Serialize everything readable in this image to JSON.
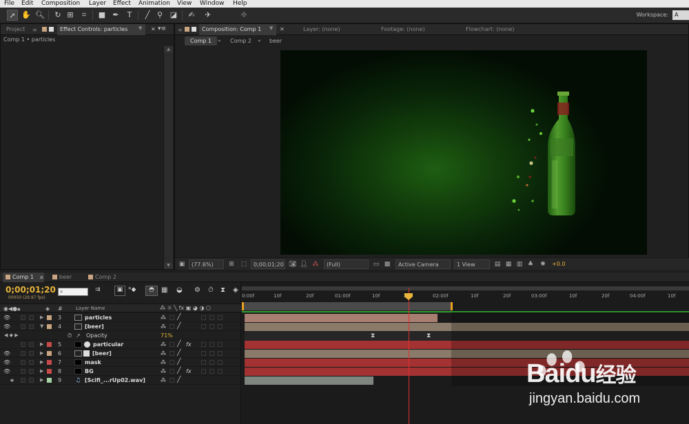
{
  "menu": [
    "File",
    "Edit",
    "Composition",
    "Layer",
    "Effect",
    "Animation",
    "View",
    "Window",
    "Help"
  ],
  "workspace": {
    "label": "Workspace:",
    "value": "A"
  },
  "left_panel": {
    "tab_project": "Project",
    "tab_effects": "Effect Controls: particles",
    "breadcrumb": "Comp 1 • particles"
  },
  "comp_panel": {
    "tab_composition": "Composition: Comp 1",
    "tab_layer": "Layer: (none)",
    "tab_footage": "Footage: (none)",
    "tab_flowchart": "Flowchart: (none)",
    "crumbs": [
      "Comp 1",
      "Comp 2",
      "beer"
    ],
    "zoom": "(77.6%)",
    "timecode": "0;00;01;20",
    "resolution": "(Full)",
    "camera": "Active Camera",
    "view": "1 View",
    "exposure": "+0.0",
    "bottle_label": "Heineken"
  },
  "timeline": {
    "tabs": [
      "Comp 1",
      "beer",
      "Comp 2"
    ],
    "timecode": "0;00;01;20",
    "frames": "00050 (29.97 fps)",
    "search_placeholder": "",
    "col_num": "#",
    "col_layer": "Layer Name",
    "ruler": [
      "0:00f",
      "10f",
      "20f",
      "01:00f",
      "10f",
      "20f",
      "02:00f",
      "10f",
      "20f",
      "03:00f",
      "10f",
      "20f",
      "04:00f",
      "10f"
    ],
    "layers": [
      {
        "num": "3",
        "name": "particles",
        "color": "#c9a581",
        "expanded": false,
        "fx": false
      },
      {
        "num": "4",
        "name": "[beer]",
        "color": "#c9a581",
        "expanded": true,
        "fx": false
      },
      {
        "num": "5",
        "name": "particular",
        "color": "#c84b4b",
        "expanded": false,
        "fx": true
      },
      {
        "num": "6",
        "name": "[beer]",
        "color": "#c9a581",
        "expanded": false,
        "fx": false
      },
      {
        "num": "7",
        "name": "mask",
        "color": "#c84b4b",
        "expanded": false,
        "fx": false
      },
      {
        "num": "8",
        "name": "BG",
        "color": "#c84b4b",
        "expanded": false,
        "fx": true
      },
      {
        "num": "9",
        "name": "[Scifi_...rUp02.wav]",
        "color": "#a5d3a5",
        "expanded": false,
        "fx": false
      }
    ],
    "property": {
      "name": "Opacity",
      "value": "71%"
    }
  },
  "watermark": {
    "brand_left": "Bai",
    "brand_right": "du",
    "brand_cn": "经验",
    "url": "jingyan.baidu.com"
  }
}
